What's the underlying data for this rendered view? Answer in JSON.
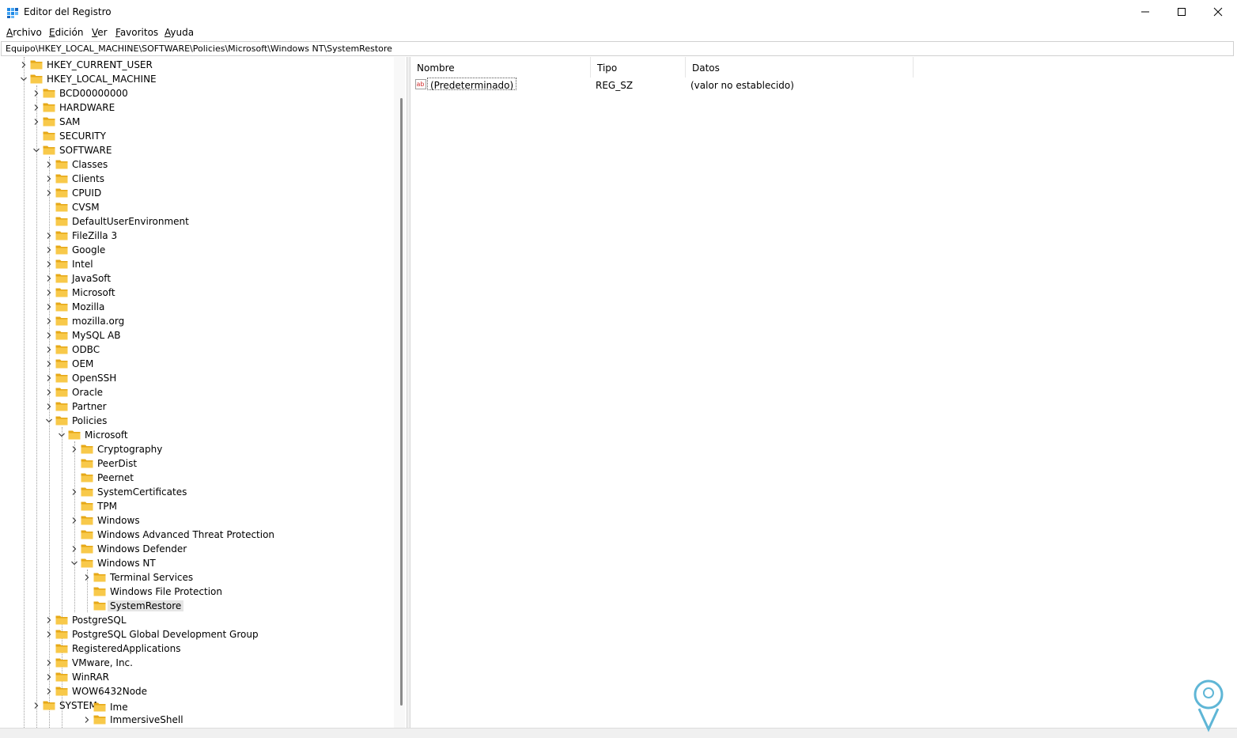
{
  "window": {
    "title": "Editor del Registro",
    "controls": [
      "minimize",
      "maximize",
      "close"
    ]
  },
  "menu": [
    {
      "label": "Archivo",
      "underline": "A",
      "rest": "rchivo"
    },
    {
      "label": "Edición",
      "underline": "E",
      "rest": "dición"
    },
    {
      "label": "Ver",
      "underline": "V",
      "rest": "er"
    },
    {
      "label": "Favoritos",
      "underline": "F",
      "rest": "avoritos"
    },
    {
      "label": "Ayuda",
      "underline": "A",
      "rest": "yuda"
    }
  ],
  "address": "Equipo\\HKEY_LOCAL_MACHINE\\SOFTWARE\\Policies\\Microsoft\\Windows NT\\SystemRestore",
  "tree": [
    {
      "label": "HKEY_CURRENT_USER",
      "level": 0,
      "expander": "collapsed"
    },
    {
      "label": "HKEY_LOCAL_MACHINE",
      "level": 0,
      "expander": "expanded"
    },
    {
      "label": "BCD00000000",
      "level": 1,
      "expander": "collapsed"
    },
    {
      "label": "HARDWARE",
      "level": 1,
      "expander": "collapsed"
    },
    {
      "label": "SAM",
      "level": 1,
      "expander": "collapsed"
    },
    {
      "label": "SECURITY",
      "level": 1,
      "expander": "none"
    },
    {
      "label": "SOFTWARE",
      "level": 1,
      "expander": "expanded"
    },
    {
      "label": "Classes",
      "level": 2,
      "expander": "collapsed"
    },
    {
      "label": "Clients",
      "level": 2,
      "expander": "collapsed"
    },
    {
      "label": "CPUID",
      "level": 2,
      "expander": "collapsed"
    },
    {
      "label": "CVSM",
      "level": 2,
      "expander": "none"
    },
    {
      "label": "DefaultUserEnvironment",
      "level": 2,
      "expander": "none"
    },
    {
      "label": "FileZilla 3",
      "level": 2,
      "expander": "collapsed"
    },
    {
      "label": "Google",
      "level": 2,
      "expander": "collapsed"
    },
    {
      "label": "Intel",
      "level": 2,
      "expander": "collapsed"
    },
    {
      "label": "JavaSoft",
      "level": 2,
      "expander": "collapsed"
    },
    {
      "label": "Microsoft",
      "level": 2,
      "expander": "collapsed"
    },
    {
      "label": "Mozilla",
      "level": 2,
      "expander": "collapsed"
    },
    {
      "label": "mozilla.org",
      "level": 2,
      "expander": "collapsed"
    },
    {
      "label": "MySQL AB",
      "level": 2,
      "expander": "collapsed"
    },
    {
      "label": "ODBC",
      "level": 2,
      "expander": "collapsed"
    },
    {
      "label": "OEM",
      "level": 2,
      "expander": "collapsed"
    },
    {
      "label": "OpenSSH",
      "level": 2,
      "expander": "collapsed"
    },
    {
      "label": "Oracle",
      "level": 2,
      "expander": "collapsed"
    },
    {
      "label": "Partner",
      "level": 2,
      "expander": "collapsed"
    },
    {
      "label": "Policies",
      "level": 2,
      "expander": "expanded"
    },
    {
      "label": "Microsoft",
      "level": 3,
      "expander": "expanded"
    },
    {
      "label": "Cryptography",
      "level": 4,
      "expander": "collapsed"
    },
    {
      "label": "PeerDist",
      "level": 4,
      "expander": "none"
    },
    {
      "label": "Peernet",
      "level": 4,
      "expander": "none"
    },
    {
      "label": "SystemCertificates",
      "level": 4,
      "expander": "collapsed"
    },
    {
      "label": "TPM",
      "level": 4,
      "expander": "none"
    },
    {
      "label": "Windows",
      "level": 4,
      "expander": "collapsed"
    },
    {
      "label": "Windows Advanced Threat Protection",
      "level": 4,
      "expander": "none"
    },
    {
      "label": "Windows Defender",
      "level": 4,
      "expander": "collapsed"
    },
    {
      "label": "Windows NT",
      "level": 4,
      "expander": "expanded"
    },
    {
      "label": "Terminal Services",
      "level": 5,
      "expander": "collapsed"
    },
    {
      "label": "Windows File Protection",
      "level": 5,
      "expander": "none"
    },
    {
      "label": "SystemRestore",
      "level": 5,
      "expander": "none",
      "selected": true
    },
    {
      "label": "PostgreSQL",
      "level": 2,
      "expander": "collapsed"
    },
    {
      "label": "PostgreSQL Global Development Group",
      "level": 2,
      "expander": "collapsed"
    },
    {
      "label": "RegisteredApplications",
      "level": 2,
      "expander": "none"
    },
    {
      "label": "VMware, Inc.",
      "level": 2,
      "expander": "collapsed"
    },
    {
      "label": "WinRAR",
      "level": 2,
      "expander": "collapsed"
    },
    {
      "label": "WOW6432Node",
      "level": 2,
      "expander": "collapsed"
    }
  ],
  "tree_overlap": [
    {
      "label": "SYSTEM",
      "level": 1,
      "expander": "collapsed"
    },
    {
      "label": "Ime",
      "level": 5,
      "expander": "none"
    },
    {
      "label": "ImmersiveShell",
      "level": 5,
      "expander": "collapsed"
    }
  ],
  "list": {
    "columns": [
      "Nombre",
      "Tipo",
      "Datos"
    ],
    "rows": [
      {
        "name": "(Predeterminado)",
        "type": "REG_SZ",
        "data": "(valor no establecido)"
      }
    ]
  },
  "colors": {
    "folder": "#f8c94a",
    "folder_dark": "#e6a817",
    "selection": "#e5e5e5",
    "accent": "#0067c0"
  }
}
